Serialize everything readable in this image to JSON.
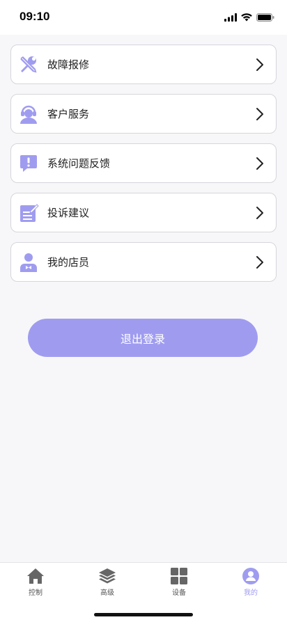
{
  "status_bar": {
    "time": "09:10"
  },
  "menu": {
    "items": [
      {
        "label": "故障报修",
        "icon": "tools-icon"
      },
      {
        "label": "客户服务",
        "icon": "headset-icon"
      },
      {
        "label": "系统问题反馈",
        "icon": "feedback-icon"
      },
      {
        "label": "投诉建议",
        "icon": "complaint-icon"
      },
      {
        "label": "我的店员",
        "icon": "staff-icon"
      }
    ]
  },
  "logout": {
    "label": "退出登录"
  },
  "tabs": [
    {
      "label": "控制",
      "icon": "home-icon",
      "active": false
    },
    {
      "label": "高级",
      "icon": "layers-icon",
      "active": false
    },
    {
      "label": "设备",
      "icon": "grid-icon",
      "active": false
    },
    {
      "label": "我的",
      "icon": "profile-icon",
      "active": true
    }
  ],
  "colors": {
    "accent": "#9f9cf0",
    "icon_fill": "#9f9cf0",
    "tab_inactive": "#555555"
  }
}
